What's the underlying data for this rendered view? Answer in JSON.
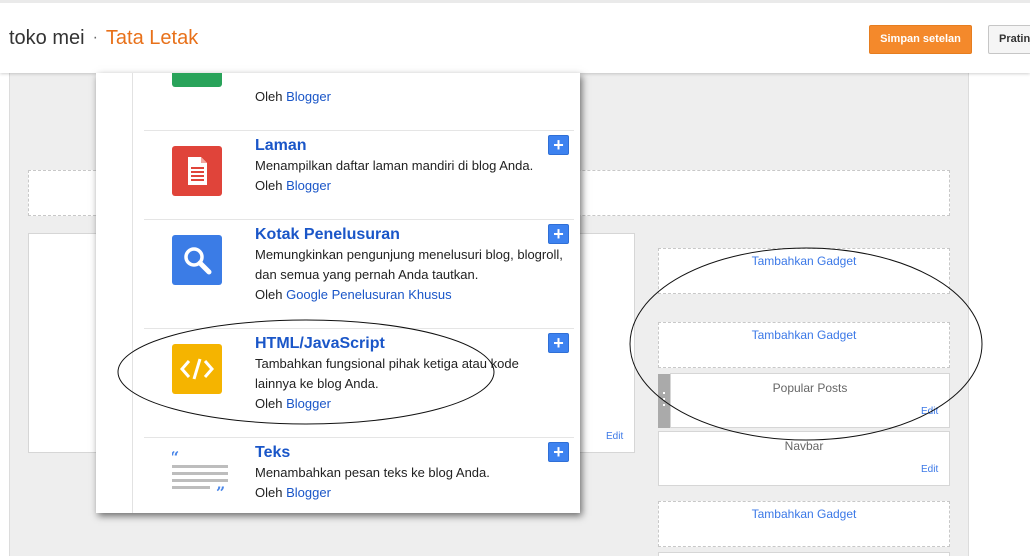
{
  "header": {
    "blog_name": "toko mei",
    "separator": "·",
    "section": "Tata Letak",
    "save_label": "Simpan setelan",
    "preview_label": "Pratinjau"
  },
  "gadgets": [
    {
      "name": "",
      "desc": "",
      "by_prefix": "Oleh",
      "by_link": "Blogger"
    },
    {
      "name": "Laman",
      "desc": "Menampilkan daftar laman mandiri di blog Anda.",
      "by_prefix": "Oleh",
      "by_link": "Blogger",
      "icon": "page-icon"
    },
    {
      "name": "Kotak Penelusuran",
      "desc": "Memungkinkan pengunjung menelusuri blog, blogroll, dan semua yang pernah Anda tautkan.",
      "by_prefix": "Oleh",
      "by_link": "Google Penelusuran Khusus",
      "icon": "search-icon"
    },
    {
      "name": "HTML/JavaScript",
      "desc": "Tambahkan fungsional pihak ketiga atau kode lainnya ke blog Anda.",
      "by_prefix": "Oleh",
      "by_link": "Blogger",
      "icon": "code-icon"
    },
    {
      "name": "Teks",
      "desc": "Menambahkan pesan teks ke blog Anda.",
      "by_prefix": "Oleh",
      "by_link": "Blogger",
      "icon": "text-icon"
    }
  ],
  "plus_label": "+",
  "layout": {
    "add_gadget": "Tambahkan Gadget",
    "popular_posts": "Popular Posts",
    "navbar": "Navbar",
    "edit": "Edit"
  },
  "colors": {
    "accent": "#e8711a",
    "save_button": "#f4892b",
    "link": "#1a56c8",
    "page_icon": "#e0443a",
    "search_icon": "#3b7ce6",
    "code_icon": "#f5b400"
  }
}
